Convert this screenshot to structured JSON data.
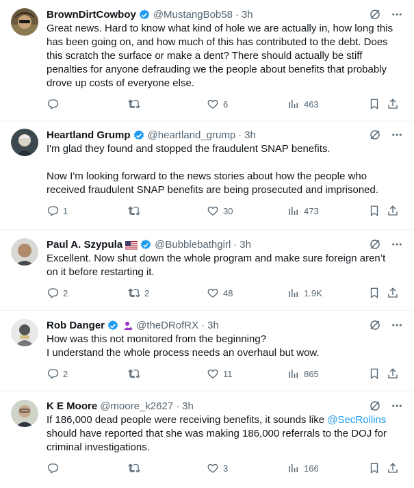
{
  "tweets": [
    {
      "name": "BrownDirtCowboy",
      "verified": true,
      "handle": "@MustangBob58",
      "time": "3h",
      "paragraphs": [
        "Great news. Hard to know what kind of hole we are actually in, how long this has been going on, and how much of this has contributed to the debt. Does this scratch the surface or make a dent? There should actually be stiff penalties for anyone defrauding we the people about benefits that probably drove up costs of everyone else."
      ],
      "stats": {
        "replies": "",
        "retweets": "",
        "likes": "6",
        "views": "463"
      }
    },
    {
      "name": "Heartland Grump",
      "verified": true,
      "handle": "@heartland_grump",
      "time": "3h",
      "paragraphs": [
        "I'm glad they found and stopped the fraudulent SNAP benefits.",
        "",
        "Now I'm looking forward to the news stories about how the people who received fraudulent SNAP benefits are being prosecuted and imprisoned."
      ],
      "stats": {
        "replies": "1",
        "retweets": "",
        "likes": "30",
        "views": "473"
      }
    },
    {
      "name": "Paul A. Szypula",
      "verified": true,
      "flag": "us-flag",
      "handle": "@Bubblebathgirl",
      "time": "3h",
      "paragraphs": [
        "Excellent. Now shut down the whole program and make sure foreign aren’t on it before restarting it."
      ],
      "stats": {
        "replies": "2",
        "retweets": "2",
        "likes": "48",
        "views": "1.9K"
      }
    },
    {
      "name": "Rob Danger",
      "verified": true,
      "affiliate": "person-badge",
      "handle": "@theDRofRX",
      "time": "3h",
      "paragraphs": [
        "How was this not monitored from the beginning?",
        "I understand the whole process needs an overhaul but wow."
      ],
      "stats": {
        "replies": "2",
        "retweets": "",
        "likes": "11",
        "views": "865"
      }
    },
    {
      "name": "K E Moore",
      "verified": false,
      "handle": "@moore_k2627",
      "time": "3h",
      "text_before": "If 186,000 dead people were receiving benefits, it sounds like ",
      "mention": "@SecRollins",
      "text_after": " should have reported that she was making 186,000 referrals to the DOJ for criminal investigations.",
      "stats": {
        "replies": "",
        "retweets": "",
        "likes": "3",
        "views": "166"
      }
    }
  ],
  "colors": {
    "text": "#0f1419",
    "secondary": "#536471",
    "link": "#1d9bf0",
    "verified": "#1d9bf0",
    "divider": "#eff3f4"
  },
  "icons": [
    "reply-icon",
    "retweet-icon",
    "like-icon",
    "views-icon",
    "bookmark-icon",
    "share-icon",
    "grok-icon",
    "more-icon",
    "verified-badge-icon"
  ]
}
